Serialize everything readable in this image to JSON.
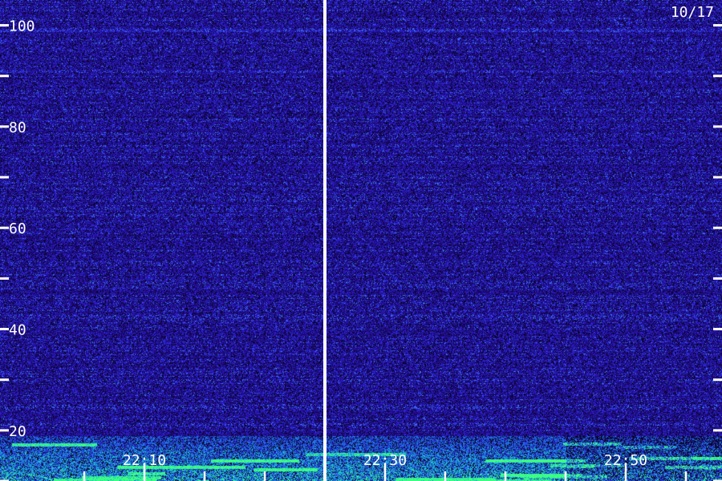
{
  "date_label": "10/17",
  "colors": {
    "background": "#000000",
    "low_noise": "#1a0a6e",
    "mid_noise": "#2a2ad0",
    "high_signal": "#22c8c0",
    "peak_signal": "#40ff80",
    "axis": "#ffffff"
  },
  "chart_data": {
    "type": "heatmap",
    "title": "",
    "xlabel": "",
    "ylabel": "",
    "y_axis": {
      "range": [
        10,
        105
      ],
      "major_ticks": [
        20,
        40,
        60,
        80,
        100
      ],
      "major_tick_labels": [
        "20",
        "40",
        "60",
        "80",
        "100"
      ],
      "minor_ticks": [
        10,
        30,
        50,
        70,
        90
      ]
    },
    "x_axis": {
      "range_minutes": [
        22.0,
        82.0
      ],
      "labeled_ticks": [
        {
          "label": "22:10",
          "minute": 34
        },
        {
          "label": "22:30",
          "minute": 54
        },
        {
          "label": "22:50",
          "minute": 74
        }
      ],
      "minor_ticks_minutes": [
        29,
        34,
        39,
        44,
        49,
        54,
        59,
        64,
        69,
        74,
        79
      ]
    },
    "divider_minute": 49,
    "bands": [
      {
        "name": "",
        "y": 99,
        "intensity": 0.6
      },
      {
        "name": "",
        "y": 91,
        "intensity": 0.3
      }
    ],
    "low_frequency_activity_below": 19,
    "grid": false
  }
}
